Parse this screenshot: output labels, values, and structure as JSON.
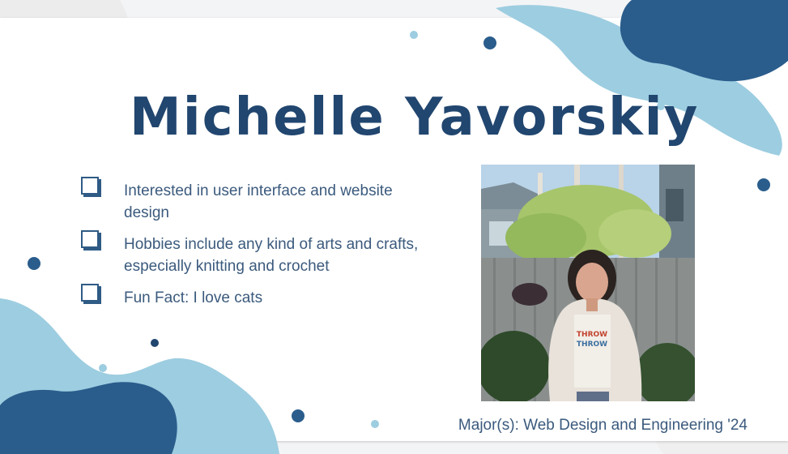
{
  "slide": {
    "title": "Michelle Yavorskiy",
    "bullets": [
      {
        "icon": "checkbox-icon",
        "text": "Interested in user interface and website design"
      },
      {
        "icon": "checkbox-icon",
        "text": "Hobbies include any kind of arts and crafts, especially knitting and crochet"
      },
      {
        "icon": "checkbox-icon",
        "text": "Fun Fact: I love cats"
      }
    ],
    "photo": {
      "shirt_text": "THROW\nTHROW"
    },
    "major": "Major(s): Web Design and Engineering '24"
  },
  "colors": {
    "dark_blue": "#2a5d8c",
    "light_blue": "#9dcde0",
    "gray_blob": "#ececec",
    "title": "#21466f",
    "body_text": "#3b5a7d"
  }
}
